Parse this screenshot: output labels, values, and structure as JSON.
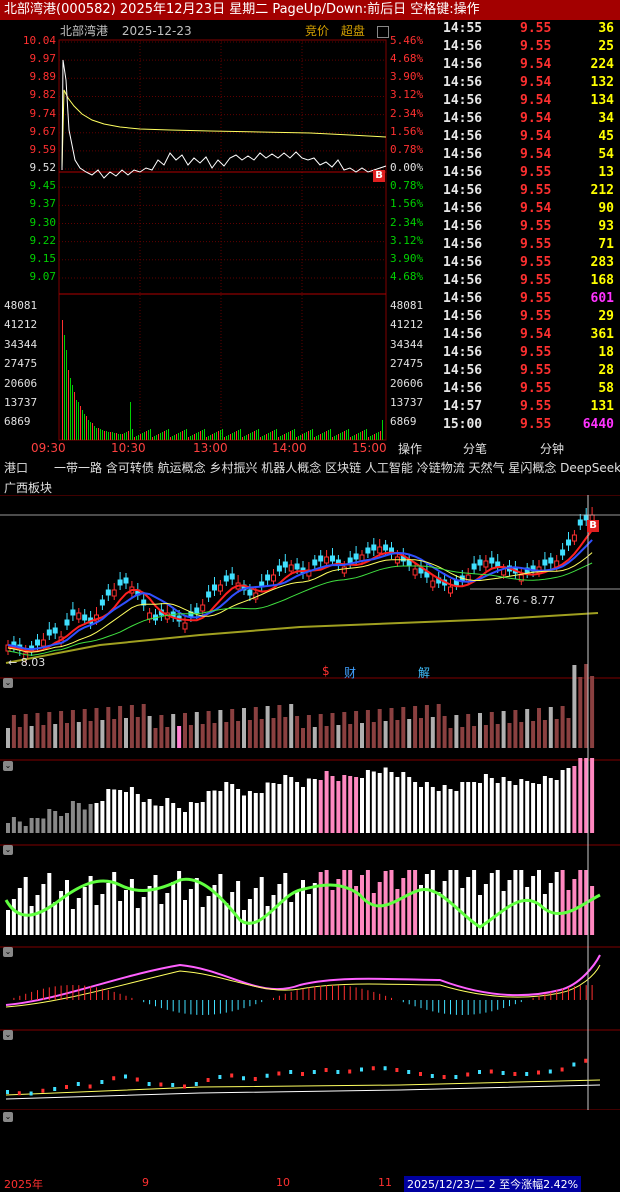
{
  "titlebar": {
    "text": "北部湾港(000582) 2025年12月23日 星期二 PageUp/Down:前后日 空格键:操作"
  },
  "intraday": {
    "name": "北部湾港",
    "date": "2025-12-23",
    "mode_buttons": [
      "竞价",
      "超盘"
    ],
    "price_ticks": [
      "10.04",
      "9.97",
      "9.89",
      "9.82",
      "9.74",
      "9.67",
      "9.59",
      "9.52",
      "9.45",
      "9.37",
      "9.30",
      "9.22",
      "9.15",
      "9.07"
    ],
    "pct_ticks": [
      "5.46%",
      "4.68%",
      "3.90%",
      "3.12%",
      "2.34%",
      "1.56%",
      "0.78%",
      "0.00%",
      "0.78%",
      "1.56%",
      "2.34%",
      "3.12%",
      "3.90%",
      "4.68%"
    ],
    "vol_ticks": [
      "48081",
      "41212",
      "34344",
      "27475",
      "20606",
      "13737",
      "6869"
    ],
    "time_labels": [
      "09:30",
      "10:30",
      "13:00",
      "14:00",
      "15:00"
    ],
    "marker": "B",
    "colors": {
      "up": "#ff3030",
      "down": "#00d000",
      "price_line": "#ffffff",
      "avg_line": "#ffff60",
      "grid": "#800000"
    }
  },
  "trades": [
    {
      "time": "14:55",
      "price": "9.55",
      "vol": "36",
      "pc": "red",
      "vc": "yellow"
    },
    {
      "time": "14:56",
      "price": "9.55",
      "vol": "25",
      "pc": "red",
      "vc": "yellow"
    },
    {
      "time": "14:56",
      "price": "9.54",
      "vol": "224",
      "pc": "red",
      "vc": "yellow"
    },
    {
      "time": "14:56",
      "price": "9.54",
      "vol": "132",
      "pc": "red",
      "vc": "yellow"
    },
    {
      "time": "14:56",
      "price": "9.54",
      "vol": "134",
      "pc": "red",
      "vc": "yellow"
    },
    {
      "time": "14:56",
      "price": "9.54",
      "vol": "34",
      "pc": "red",
      "vc": "yellow"
    },
    {
      "time": "14:56",
      "price": "9.54",
      "vol": "45",
      "pc": "red",
      "vc": "yellow"
    },
    {
      "time": "14:56",
      "price": "9.54",
      "vol": "54",
      "pc": "red",
      "vc": "yellow"
    },
    {
      "time": "14:56",
      "price": "9.55",
      "vol": "13",
      "pc": "red",
      "vc": "yellow"
    },
    {
      "time": "14:56",
      "price": "9.55",
      "vol": "212",
      "pc": "red",
      "vc": "yellow"
    },
    {
      "time": "14:56",
      "price": "9.54",
      "vol": "90",
      "pc": "red",
      "vc": "yellow"
    },
    {
      "time": "14:56",
      "price": "9.55",
      "vol": "93",
      "pc": "red",
      "vc": "yellow"
    },
    {
      "time": "14:56",
      "price": "9.55",
      "vol": "71",
      "pc": "red",
      "vc": "yellow"
    },
    {
      "time": "14:56",
      "price": "9.55",
      "vol": "283",
      "pc": "red",
      "vc": "yellow"
    },
    {
      "time": "14:56",
      "price": "9.55",
      "vol": "168",
      "pc": "red",
      "vc": "yellow"
    },
    {
      "time": "14:56",
      "price": "9.55",
      "vol": "601",
      "pc": "red",
      "vc": "magenta"
    },
    {
      "time": "14:56",
      "price": "9.55",
      "vol": "29",
      "pc": "red",
      "vc": "yellow"
    },
    {
      "time": "14:56",
      "price": "9.54",
      "vol": "361",
      "pc": "red",
      "vc": "yellow"
    },
    {
      "time": "14:56",
      "price": "9.55",
      "vol": "18",
      "pc": "red",
      "vc": "yellow"
    },
    {
      "time": "14:56",
      "price": "9.55",
      "vol": "28",
      "pc": "red",
      "vc": "yellow"
    },
    {
      "time": "14:56",
      "price": "9.55",
      "vol": "58",
      "pc": "red",
      "vc": "yellow"
    },
    {
      "time": "14:57",
      "price": "9.55",
      "vol": "131",
      "pc": "red",
      "vc": "yellow"
    },
    {
      "time": "15:00",
      "price": "9.55",
      "vol": "6440",
      "pc": "red",
      "vc": "magenta"
    }
  ],
  "tabs": [
    "操作",
    "分笔",
    "分钟"
  ],
  "concepts": {
    "prefix": "港口",
    "list": "一带一路 含可转债 航运概念 乡村振兴 机器人概念 区块链 人工智能 冷链物流 天然气 星闪概念 DeepSeek"
  },
  "sector": "广西板块",
  "kline": {
    "low_label": "8.03",
    "range_label": "8.76 - 8.77",
    "marker": "B",
    "event_labels": [
      "$",
      "财",
      "解"
    ]
  },
  "bottom_axis": {
    "labels": [
      "2025年",
      "9",
      "10",
      "11"
    ],
    "status": "2025/12/23/二 2 至今涨幅2.42%"
  }
}
